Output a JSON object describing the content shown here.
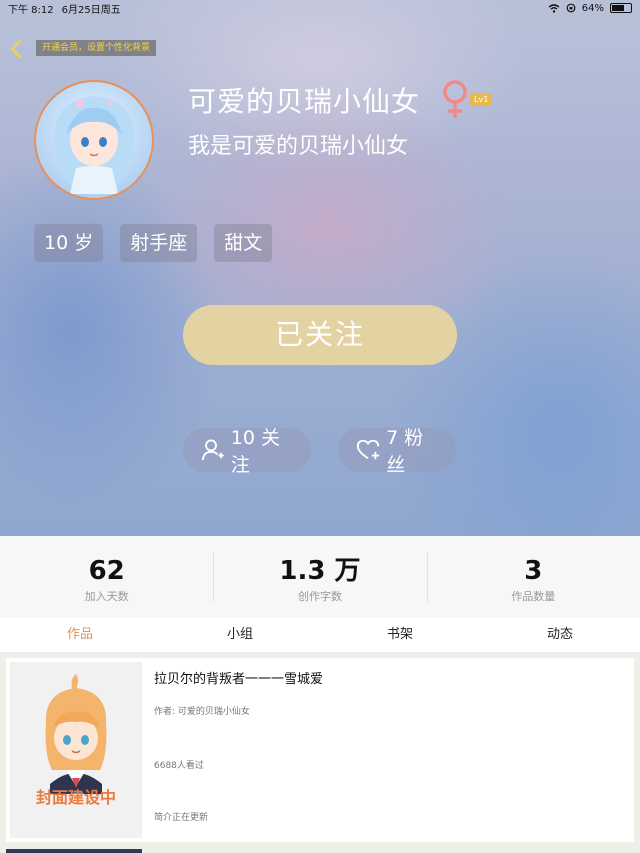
{
  "status_bar": {
    "time": "下午 8:12",
    "date": "6月25日周五",
    "battery": "64%",
    "battery_level": 0.64
  },
  "header": {
    "vip_banner": "开通会员，设置个性化背景"
  },
  "profile": {
    "name": "可爱的贝瑞小仙女",
    "level": "Lv1",
    "signature": "我是可爱的贝瑞小仙女",
    "tags": [
      "10 岁",
      "射手座",
      "甜文"
    ],
    "follow_button": "已关注",
    "following": "10 关注",
    "fans": "7 粉丝",
    "gender_color": "#f08a8a"
  },
  "stats": [
    {
      "value": "62",
      "label": "加入天数"
    },
    {
      "value": "1.3 万",
      "label": "创作字数"
    },
    {
      "value": "3",
      "label": "作品数量"
    }
  ],
  "tabs": [
    "作品",
    "小组",
    "书架",
    "动态"
  ],
  "books": [
    {
      "title": "拉贝尔的背叛者一一一雪城爱",
      "author": "作者: 可爱的贝瑞小仙女",
      "views": "6688人看过",
      "intro": "简介正在更新",
      "cover_caption": "封面建设中"
    }
  ],
  "colors": {
    "accent": "#e8924e",
    "follow_button": "#e3d2a2",
    "vip_text": "#f3d44c"
  }
}
